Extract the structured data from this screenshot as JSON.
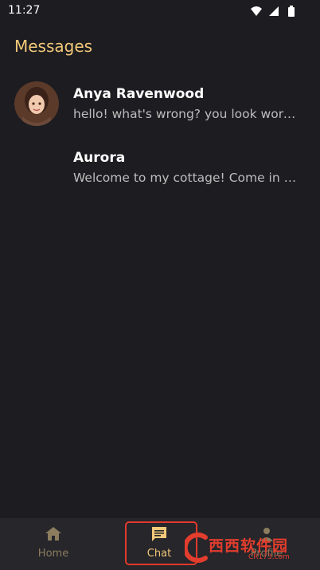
{
  "status_bar": {
    "time": "11:27",
    "icons": [
      "wifi-icon",
      "signal-icon",
      "battery-icon"
    ]
  },
  "page": {
    "title": "Messages"
  },
  "chats": [
    {
      "name": "Anya Ravenwood",
      "preview": "hello! what's wrong? you look worried"
    },
    {
      "name": "Aurora",
      "preview": "Welcome to my cottage! Come in and relax"
    }
  ],
  "nav": {
    "home_label": "Home",
    "chat_label": "Chat",
    "profile_label": "Profile"
  },
  "watermark": {
    "text": "西西软件园",
    "sub": "CR173.com"
  },
  "colors": {
    "accent": "#f2c879",
    "background": "#1d1d21",
    "nav_bg": "#26262b",
    "highlight": "#e3392c"
  }
}
